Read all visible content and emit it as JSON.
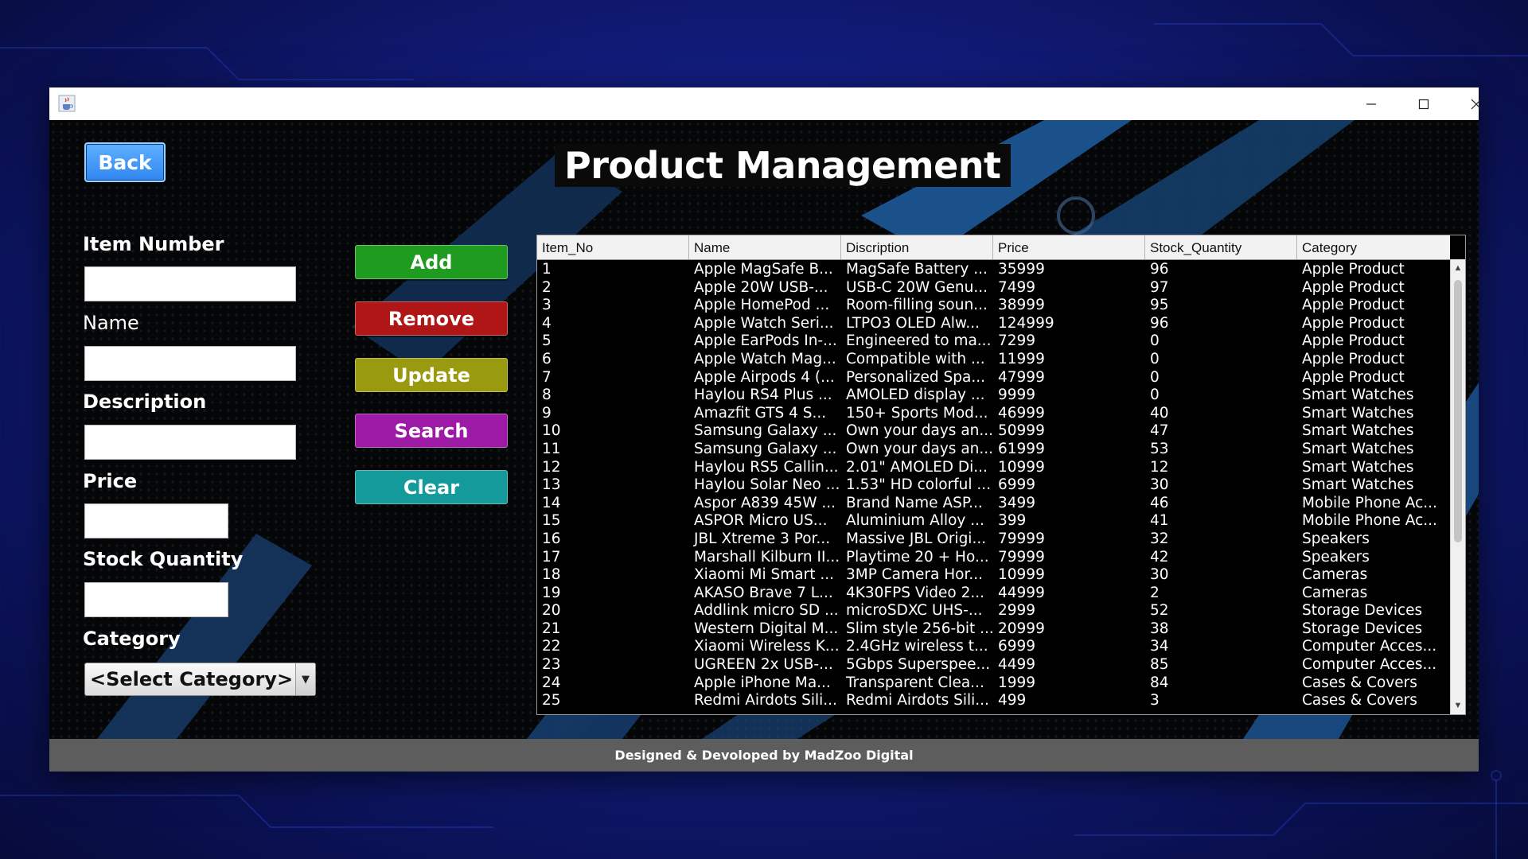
{
  "window": {
    "icon": "java-cup-icon",
    "controls": [
      "minimize-icon",
      "maximize-icon",
      "close-icon"
    ]
  },
  "header": {
    "back_label": "Back",
    "title": "Product Management"
  },
  "form": {
    "item_number_label": "Item Number",
    "item_number_value": "",
    "name_label": "Name",
    "name_value": "",
    "description_label": "Description",
    "description_value": "",
    "price_label": "Price",
    "price_value": "",
    "stock_label": "Stock Quantity",
    "stock_value": "",
    "category_label": "Category",
    "category_selected": "<Select Category>"
  },
  "actions": {
    "add": {
      "label": "Add",
      "color": "#1f9c1f"
    },
    "remove": {
      "label": "Remove",
      "color": "#b11616"
    },
    "update": {
      "label": "Update",
      "color": "#9a9a10"
    },
    "search": {
      "label": "Search",
      "color": "#9c1aa6"
    },
    "clear": {
      "label": "Clear",
      "color": "#159a9c"
    }
  },
  "table": {
    "columns": [
      "Item_No",
      "Name",
      "Discription",
      "Price",
      "Stock_Quantity",
      "Category"
    ],
    "rows": [
      [
        "1",
        "Apple MagSafe B...",
        "MagSafe Battery ...",
        "35999",
        "96",
        "Apple Product"
      ],
      [
        "2",
        "Apple 20W USB-...",
        "USB-C 20W Genu...",
        "7499",
        "97",
        "Apple Product"
      ],
      [
        "3",
        "Apple HomePod ...",
        "Room-filling soun...",
        "38999",
        "95",
        "Apple Product"
      ],
      [
        "4",
        "Apple Watch Seri...",
        "LTPO3 OLED Alw...",
        "124999",
        "96",
        "Apple Product"
      ],
      [
        "5",
        "Apple EarPods In-...",
        "Engineered to ma...",
        "7299",
        "0",
        "Apple Product"
      ],
      [
        "6",
        "Apple Watch Mag...",
        "Compatible with ...",
        "11999",
        "0",
        "Apple Product"
      ],
      [
        "7",
        "Apple Airpods 4 (...",
        "Personalized Spa...",
        "47999",
        "0",
        "Apple Product"
      ],
      [
        "8",
        "Haylou RS4 Plus ...",
        "AMOLED display ...",
        "9999",
        "0",
        "Smart Watches"
      ],
      [
        "9",
        "Amazfit GTS 4 S...",
        "150+ Sports Mod...",
        "46999",
        "40",
        "Smart Watches"
      ],
      [
        "10",
        "Samsung Galaxy ...",
        "Own your days an...",
        "50999",
        "47",
        "Smart Watches"
      ],
      [
        "11",
        "Samsung Galaxy ...",
        "Own your days an...",
        "61999",
        "53",
        "Smart Watches"
      ],
      [
        "12",
        "Haylou RS5 Callin...",
        "2.01\" AMOLED Di...",
        "10999",
        "12",
        "Smart Watches"
      ],
      [
        "13",
        "Haylou Solar Neo ...",
        "1.53\" HD colorful ...",
        "6999",
        "30",
        "Smart Watches"
      ],
      [
        "14",
        "Aspor A839 45W ...",
        "Brand Name ASP...",
        "3499",
        "46",
        "Mobile Phone Ac..."
      ],
      [
        "15",
        "ASPOR Micro US...",
        "Aluminium Alloy ...",
        "399",
        "41",
        "Mobile Phone Ac..."
      ],
      [
        "16",
        "JBL Xtreme 3 Por...",
        "Massive JBL Origi...",
        "79999",
        "32",
        "Speakers"
      ],
      [
        "17",
        "Marshall Kilburn II...",
        "Playtime 20 + Ho...",
        "79999",
        "42",
        "Speakers"
      ],
      [
        "18",
        "Xiaomi Mi Smart ...",
        "3MP Camera Hor...",
        "10999",
        "30",
        "Cameras"
      ],
      [
        "19",
        "AKASO Brave 7 L...",
        "4K30FPS Video 2...",
        "44999",
        "2",
        "Cameras"
      ],
      [
        "20",
        "Addlink micro SD ...",
        "microSDXC UHS-...",
        "2999",
        "52",
        "Storage Devices"
      ],
      [
        "21",
        "Western Digital M...",
        "Slim style 256-bit ...",
        "20999",
        "38",
        "Storage Devices"
      ],
      [
        "22",
        "Xiaomi Wireless K...",
        "2.4GHz wireless t...",
        "6999",
        "34",
        "Computer Acces..."
      ],
      [
        "23",
        "UGREEN 2x USB-...",
        "5Gbps Superspee...",
        "4499",
        "85",
        "Computer Acces..."
      ],
      [
        "24",
        "Apple iPhone Ma...",
        "Transparent Clea...",
        "1999",
        "84",
        "Cases & Covers"
      ],
      [
        "25",
        "Redmi Airdots Sili...",
        "Redmi Airdots Sili...",
        "499",
        "3",
        "Cases & Covers"
      ]
    ]
  },
  "footer": {
    "text": "Designed & Devoloped by MadZoo Digital"
  }
}
